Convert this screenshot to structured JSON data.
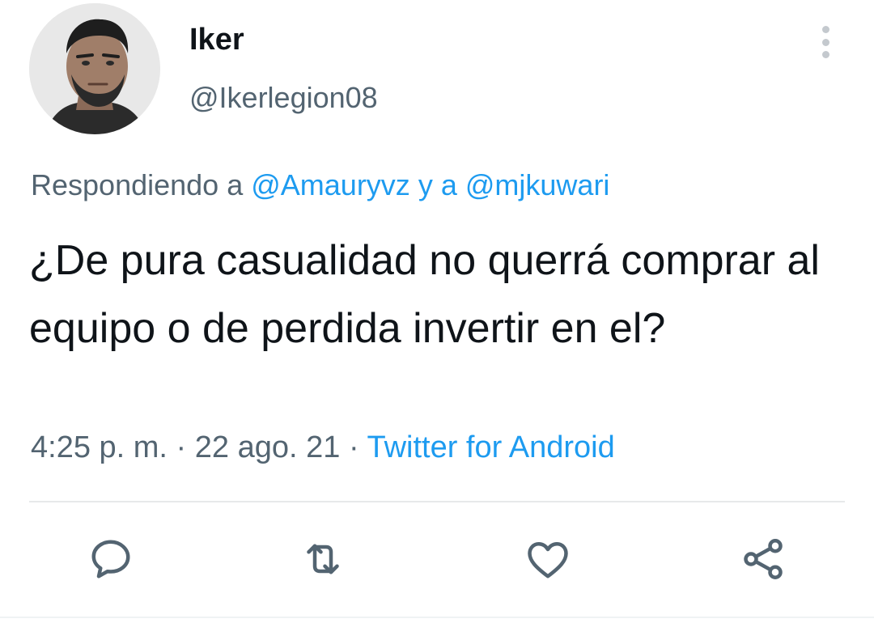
{
  "user": {
    "display_name": "Iker",
    "handle": "@Ikerlegion08"
  },
  "reply": {
    "prefix": "Respondiendo a",
    "mention_1": "@Amauryvz",
    "connector": "y a",
    "mention_2": "@mjkuwari"
  },
  "tweet": {
    "text": "¿De pura casualidad no querrá comprar al equipo o de perdida invertir en el?"
  },
  "meta": {
    "time": "4:25 p. m.",
    "separator": "·",
    "date": "22 ago. 21",
    "source": "Twitter for Android"
  },
  "icons": {
    "more": "more-vertical-icon",
    "reply": "reply-bubble-icon",
    "retweet": "retweet-icon",
    "like": "heart-icon",
    "share": "share-icon"
  },
  "colors": {
    "text": "#0f1419",
    "secondary": "#536471",
    "link": "#1d9bf0",
    "divider": "#e7e9ea"
  }
}
